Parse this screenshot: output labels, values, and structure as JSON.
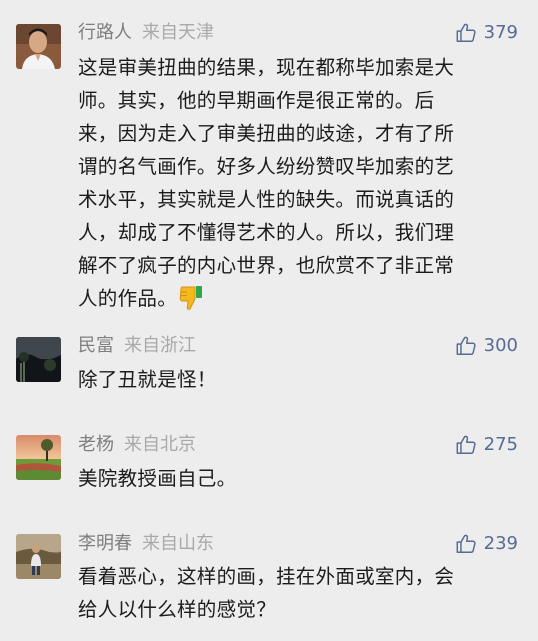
{
  "comments": [
    {
      "user": "行路人",
      "location": "来自天津",
      "likes": "379",
      "avatar_icon": "man-portrait-avatar",
      "lines": [
        "这是审美扭曲的结果，现在都称毕加索是大",
        "师。其实，他的早期画作是很正常的。后",
        "来，因为走入了审美扭曲的歧途，才有了所",
        "谓的名气画作。好多人纷纷赞叹毕加索的艺",
        "术水平，其实就是人性的缺失。而说真话的",
        "人，却成了不懂得艺术的人。所以，我们理",
        "解不了疯子的内心世界，也欣赏不了非正常",
        "人的作品。"
      ],
      "trailing_emoji": "thumbs-down-emoji"
    },
    {
      "user": "民富",
      "location": "来自浙江",
      "likes": "300",
      "avatar_icon": "dark-landscape-avatar",
      "lines": [
        "除了丑就是怪！"
      ]
    },
    {
      "user": "老杨",
      "location": "来自北京",
      "likes": "275",
      "avatar_icon": "sunset-field-avatar",
      "lines": [
        "美院教授画自己。"
      ]
    },
    {
      "user": "李明春",
      "location": "来自山东",
      "likes": "239",
      "avatar_icon": "person-outdoor-avatar",
      "lines": [
        "看着恶心，这样的画，挂在外面或室内，会",
        "给人以什么样的感觉？"
      ]
    }
  ],
  "colors": {
    "background": "#ededed",
    "name": "#7f7f7f",
    "location": "#a9a9a9",
    "like_accent": "#576b95",
    "text": "#1b1b1b"
  }
}
